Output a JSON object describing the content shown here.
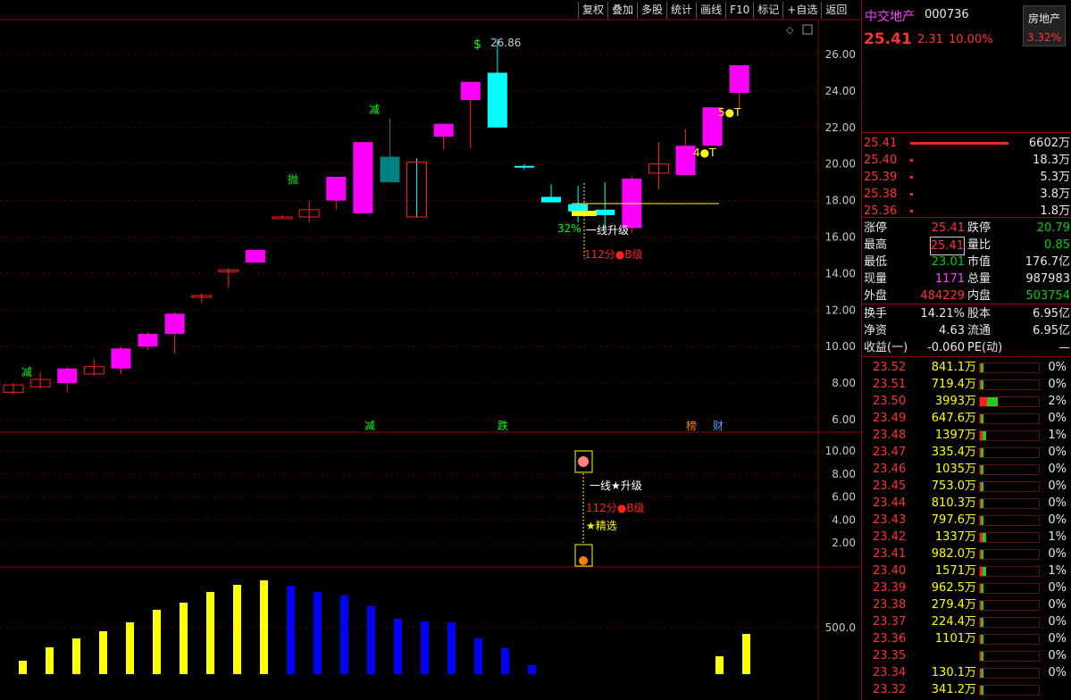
{
  "toolbar": [
    "复权",
    "叠加",
    "多股",
    "统计",
    "画线",
    "F10",
    "标记",
    "+自选",
    "返回"
  ],
  "stock": {
    "name": "中交地产",
    "code": "000736",
    "sector": "房地产",
    "sector_pct": "3.32%",
    "price": "25.41",
    "change": "2.31",
    "change_pct": "10.00%"
  },
  "order_book": [
    {
      "price": "25.41",
      "vol": "6602万"
    },
    {
      "price": "25.40",
      "vol": "18.3万"
    },
    {
      "price": "25.39",
      "vol": "5.3万"
    },
    {
      "price": "25.38",
      "vol": "3.8万"
    },
    {
      "price": "25.36",
      "vol": "1.8万"
    }
  ],
  "stats": [
    {
      "l1": "涨停",
      "v1": "25.41",
      "l2": "跌停",
      "v2": "20.79"
    },
    {
      "l1": "最高",
      "v1": "25.41",
      "l2": "量比",
      "v2": "0.85"
    },
    {
      "l1": "最低",
      "v1": "23.01",
      "l2": "市值",
      "v2": "176.7亿"
    },
    {
      "l1": "现量",
      "v1": "1171",
      "l2": "总量",
      "v2": "987983"
    },
    {
      "l1": "外盘",
      "v1": "484229",
      "l2": "内盘",
      "v2": "503754"
    }
  ],
  "stats2": [
    {
      "l1": "换手",
      "v1": "14.21%",
      "l2": "股本",
      "v2": "6.95亿"
    },
    {
      "l1": "净资",
      "v1": "4.63",
      "l2": "流通",
      "v2": "6.95亿"
    },
    {
      "l1": "收益(一)",
      "v1": "-0.060",
      "l2": "PE(动)",
      "v2": "—"
    }
  ],
  "depth": [
    {
      "p": "23.52",
      "v": "841.1万",
      "pct": "0%"
    },
    {
      "p": "23.51",
      "v": "719.4万",
      "pct": "0%"
    },
    {
      "p": "23.50",
      "v": "3993万",
      "pct": "2%"
    },
    {
      "p": "23.49",
      "v": "647.6万",
      "pct": "0%"
    },
    {
      "p": "23.48",
      "v": "1397万",
      "pct": "1%"
    },
    {
      "p": "23.47",
      "v": "335.4万",
      "pct": "0%"
    },
    {
      "p": "23.46",
      "v": "1035万",
      "pct": "0%"
    },
    {
      "p": "23.45",
      "v": "753.0万",
      "pct": "0%"
    },
    {
      "p": "23.44",
      "v": "810.3万",
      "pct": "0%"
    },
    {
      "p": "23.43",
      "v": "797.6万",
      "pct": "0%"
    },
    {
      "p": "23.42",
      "v": "1337万",
      "pct": "1%"
    },
    {
      "p": "23.41",
      "v": "982.0万",
      "pct": "0%"
    },
    {
      "p": "23.40",
      "v": "1571万",
      "pct": "1%"
    },
    {
      "p": "23.39",
      "v": "962.5万",
      "pct": "0%"
    },
    {
      "p": "23.38",
      "v": "279.4万",
      "pct": "0%"
    },
    {
      "p": "23.37",
      "v": "224.4万",
      "pct": "0%"
    },
    {
      "p": "23.36",
      "v": "1101万",
      "pct": "0%"
    },
    {
      "p": "23.35",
      "v": "",
      "pct": "0%"
    },
    {
      "p": "23.34",
      "v": "130.1万",
      "pct": "0%"
    },
    {
      "p": "23.32",
      "v": "341.2万",
      "pct": ""
    }
  ],
  "chart_data": {
    "type": "candlestick",
    "price_ticks": [
      "26.00",
      "24.00",
      "22.00",
      "20.00",
      "18.00",
      "16.00",
      "14.00",
      "12.00",
      "10.00",
      "8.00",
      "6.00"
    ],
    "indicator_ticks": [
      "10.00",
      "8.00",
      "6.00",
      "4.00",
      "2.00"
    ],
    "volume_ticks": [
      "500.0"
    ],
    "high_label": "26.86",
    "annotations": [
      "减",
      "抛",
      "减",
      "32%",
      "一线升级",
      "112分●B级",
      "4●T",
      "5●T"
    ],
    "bottom_markers": [
      "减",
      "跌",
      "榜",
      "财"
    ],
    "signal_texts": [
      "一线★升级",
      "112分●B级",
      "★精选"
    ],
    "candles": [
      {
        "o": 7.5,
        "c": 7.9,
        "h": 8.0,
        "l": 7.4
      },
      {
        "o": 7.8,
        "c": 8.2,
        "h": 8.6,
        "l": 7.7
      },
      {
        "o": 8.0,
        "c": 8.8,
        "h": 8.9,
        "l": 7.5
      },
      {
        "o": 8.5,
        "c": 8.9,
        "h": 9.3,
        "l": 8.4
      },
      {
        "o": 8.8,
        "c": 9.9,
        "h": 10.0,
        "l": 8.5
      },
      {
        "o": 10.0,
        "c": 10.7,
        "h": 10.8,
        "l": 9.8
      },
      {
        "o": 10.7,
        "c": 11.8,
        "h": 11.9,
        "l": 9.6
      },
      {
        "o": 12.8,
        "c": 12.8,
        "h": 12.9,
        "l": 12.4
      },
      {
        "o": 14.2,
        "c": 14.2,
        "h": 14.3,
        "l": 13.2
      },
      {
        "o": 14.6,
        "c": 15.3,
        "h": 15.3,
        "l": 14.6
      },
      {
        "o": 17.1,
        "c": 17.1,
        "h": 17.2,
        "l": 17.0
      },
      {
        "o": 17.1,
        "c": 17.5,
        "h": 18.0,
        "l": 16.8
      },
      {
        "o": 18.0,
        "c": 19.3,
        "h": 19.3,
        "l": 17.5
      },
      {
        "o": 17.3,
        "c": 21.2,
        "h": 21.2,
        "l": 17.3
      },
      {
        "o": 20.4,
        "c": 19.0,
        "h": 22.5,
        "l": 19.0
      },
      {
        "o": 20.1,
        "c": 17.1,
        "h": 20.3,
        "l": 17.1
      },
      {
        "o": 21.5,
        "c": 22.2,
        "h": 22.2,
        "l": 20.8
      },
      {
        "o": 23.5,
        "c": 24.5,
        "h": 24.5,
        "l": 20.9
      },
      {
        "o": 25.0,
        "c": 22.0,
        "h": 26.86,
        "l": 22.0
      },
      {
        "o": 19.9,
        "c": 19.8,
        "h": 20.0,
        "l": 19.7
      },
      {
        "o": 18.2,
        "c": 17.9,
        "h": 18.9,
        "l": 17.9
      },
      {
        "o": 17.8,
        "c": 17.4,
        "h": 18.8,
        "l": 16.8
      },
      {
        "o": 17.5,
        "c": 17.2,
        "h": 19.0,
        "l": 16.4
      },
      {
        "o": 16.5,
        "c": 19.2,
        "h": 19.3,
        "l": 16.2
      },
      {
        "o": 19.5,
        "c": 20.0,
        "h": 21.2,
        "l": 18.6
      },
      {
        "o": 19.4,
        "c": 21.0,
        "h": 21.9,
        "l": 19.4
      },
      {
        "o": 21.0,
        "c": 23.1,
        "h": 23.1,
        "l": 21.0
      },
      {
        "o": 23.9,
        "c": 25.41,
        "h": 25.41,
        "l": 23.01
      }
    ],
    "volumes": [
      150,
      300,
      400,
      480,
      580,
      720,
      800,
      920,
      1000,
      1050,
      990,
      920,
      880,
      760,
      620,
      590,
      580,
      400,
      290,
      100,
      0,
      0,
      0,
      0,
      0,
      0,
      200,
      450
    ],
    "volume_colors": [
      "y",
      "y",
      "y",
      "y",
      "y",
      "y",
      "y",
      "y",
      "y",
      "y",
      "b",
      "b",
      "b",
      "b",
      "b",
      "b",
      "b",
      "b",
      "b",
      "b",
      "n",
      "n",
      "n",
      "n",
      "n",
      "n",
      "y",
      "y"
    ]
  }
}
